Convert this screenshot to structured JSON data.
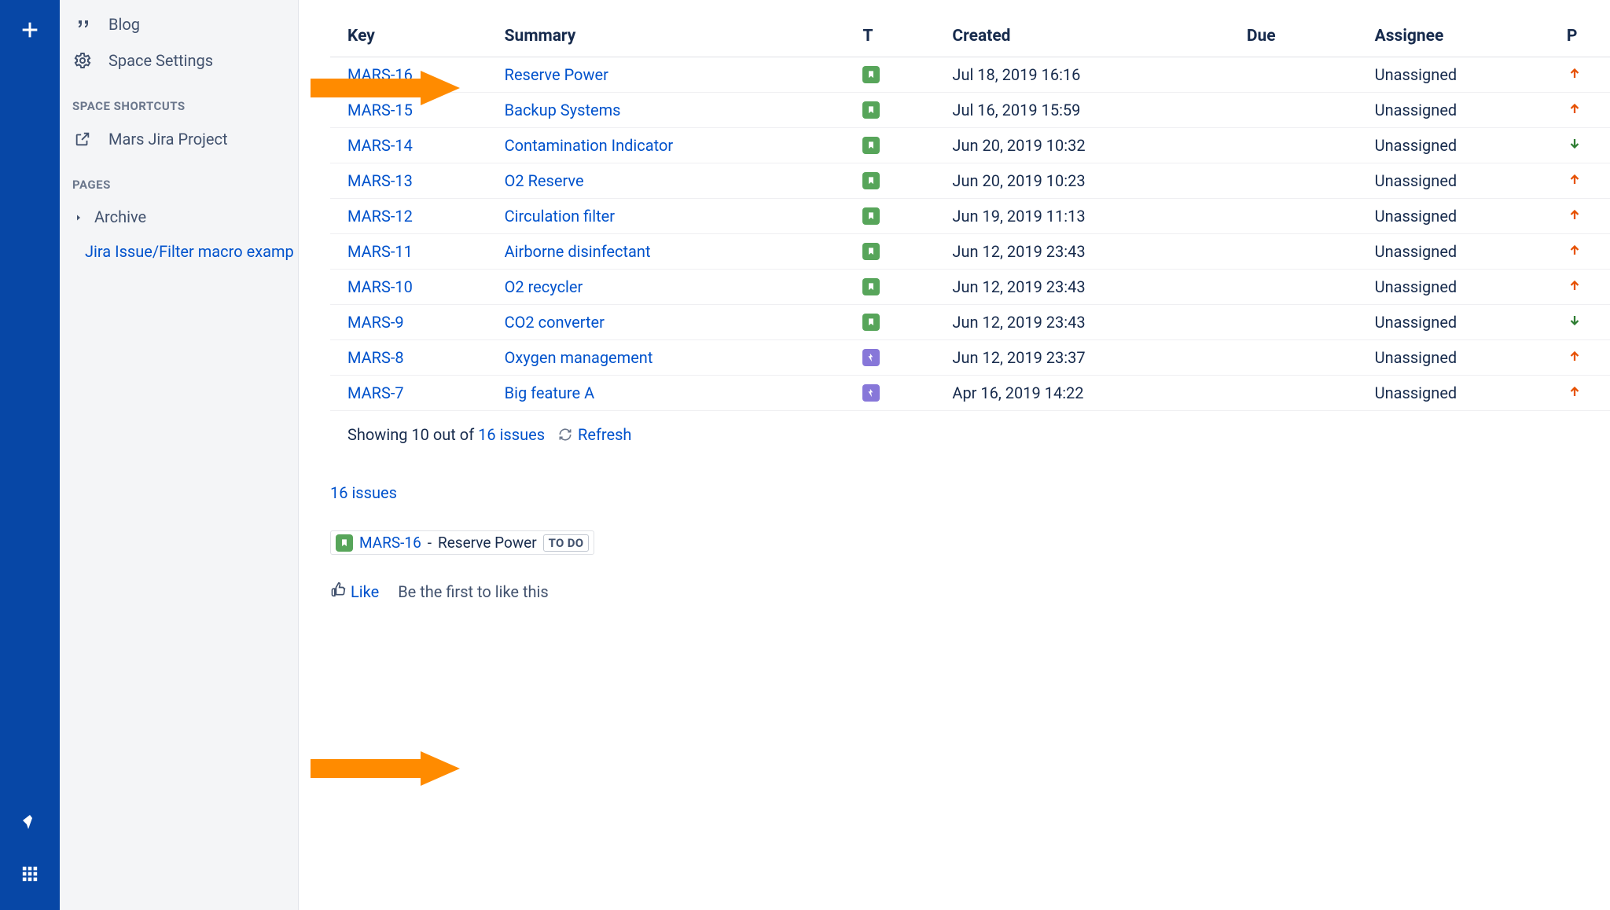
{
  "sidebar": {
    "blog": "Blog",
    "space_settings": "Space Settings",
    "shortcuts_heading": "SPACE SHORTCUTS",
    "shortcut_mars": "Mars Jira Project",
    "pages_heading": "PAGES",
    "archive": "Archive",
    "current_page": "Jira Issue/Filter macro examp"
  },
  "table": {
    "headers": {
      "key": "Key",
      "summary": "Summary",
      "t": "T",
      "created": "Created",
      "due": "Due",
      "assignee": "Assignee",
      "p": "P"
    },
    "rows": [
      {
        "key": "MARS-16",
        "summary": "Reserve Power",
        "type": "story",
        "created": "Jul 18, 2019 16:16",
        "due": "",
        "assignee": "Unassigned",
        "priority": "up-orange"
      },
      {
        "key": "MARS-15",
        "summary": "Backup Systems",
        "type": "story",
        "created": "Jul 16, 2019 15:59",
        "due": "",
        "assignee": "Unassigned",
        "priority": "up-orange"
      },
      {
        "key": "MARS-14",
        "summary": "Contamination Indicator",
        "type": "story",
        "created": "Jun 20, 2019 10:32",
        "due": "",
        "assignee": "Unassigned",
        "priority": "down-green"
      },
      {
        "key": "MARS-13",
        "summary": "O2 Reserve",
        "type": "story",
        "created": "Jun 20, 2019 10:23",
        "due": "",
        "assignee": "Unassigned",
        "priority": "up-orange"
      },
      {
        "key": "MARS-12",
        "summary": "Circulation filter",
        "type": "story",
        "created": "Jun 19, 2019 11:13",
        "due": "",
        "assignee": "Unassigned",
        "priority": "up-orange"
      },
      {
        "key": "MARS-11",
        "summary": "Airborne disinfectant",
        "type": "story",
        "created": "Jun 12, 2019 23:43",
        "due": "",
        "assignee": "Unassigned",
        "priority": "up-orange"
      },
      {
        "key": "MARS-10",
        "summary": "O2 recycler",
        "type": "story",
        "created": "Jun 12, 2019 23:43",
        "due": "",
        "assignee": "Unassigned",
        "priority": "up-orange"
      },
      {
        "key": "MARS-9",
        "summary": "CO2 converter",
        "type": "story",
        "created": "Jun 12, 2019 23:43",
        "due": "",
        "assignee": "Unassigned",
        "priority": "down-green"
      },
      {
        "key": "MARS-8",
        "summary": "Oxygen management",
        "type": "epic",
        "created": "Jun 12, 2019 23:37",
        "due": "",
        "assignee": "Unassigned",
        "priority": "up-orange"
      },
      {
        "key": "MARS-7",
        "summary": "Big feature A",
        "type": "epic",
        "created": "Apr 16, 2019 14:22",
        "due": "",
        "assignee": "Unassigned",
        "priority": "up-orange"
      }
    ]
  },
  "footer": {
    "showing_prefix": "Showing 10 out of ",
    "showing_link": "16 issues",
    "refresh": "Refresh",
    "all_issues_link": "16 issues"
  },
  "single_issue": {
    "type": "story",
    "key": "MARS-16",
    "sep": " - ",
    "summary": "Reserve Power",
    "status": "TO DO"
  },
  "like": {
    "button": "Like",
    "hint": "Be the first to like this"
  }
}
